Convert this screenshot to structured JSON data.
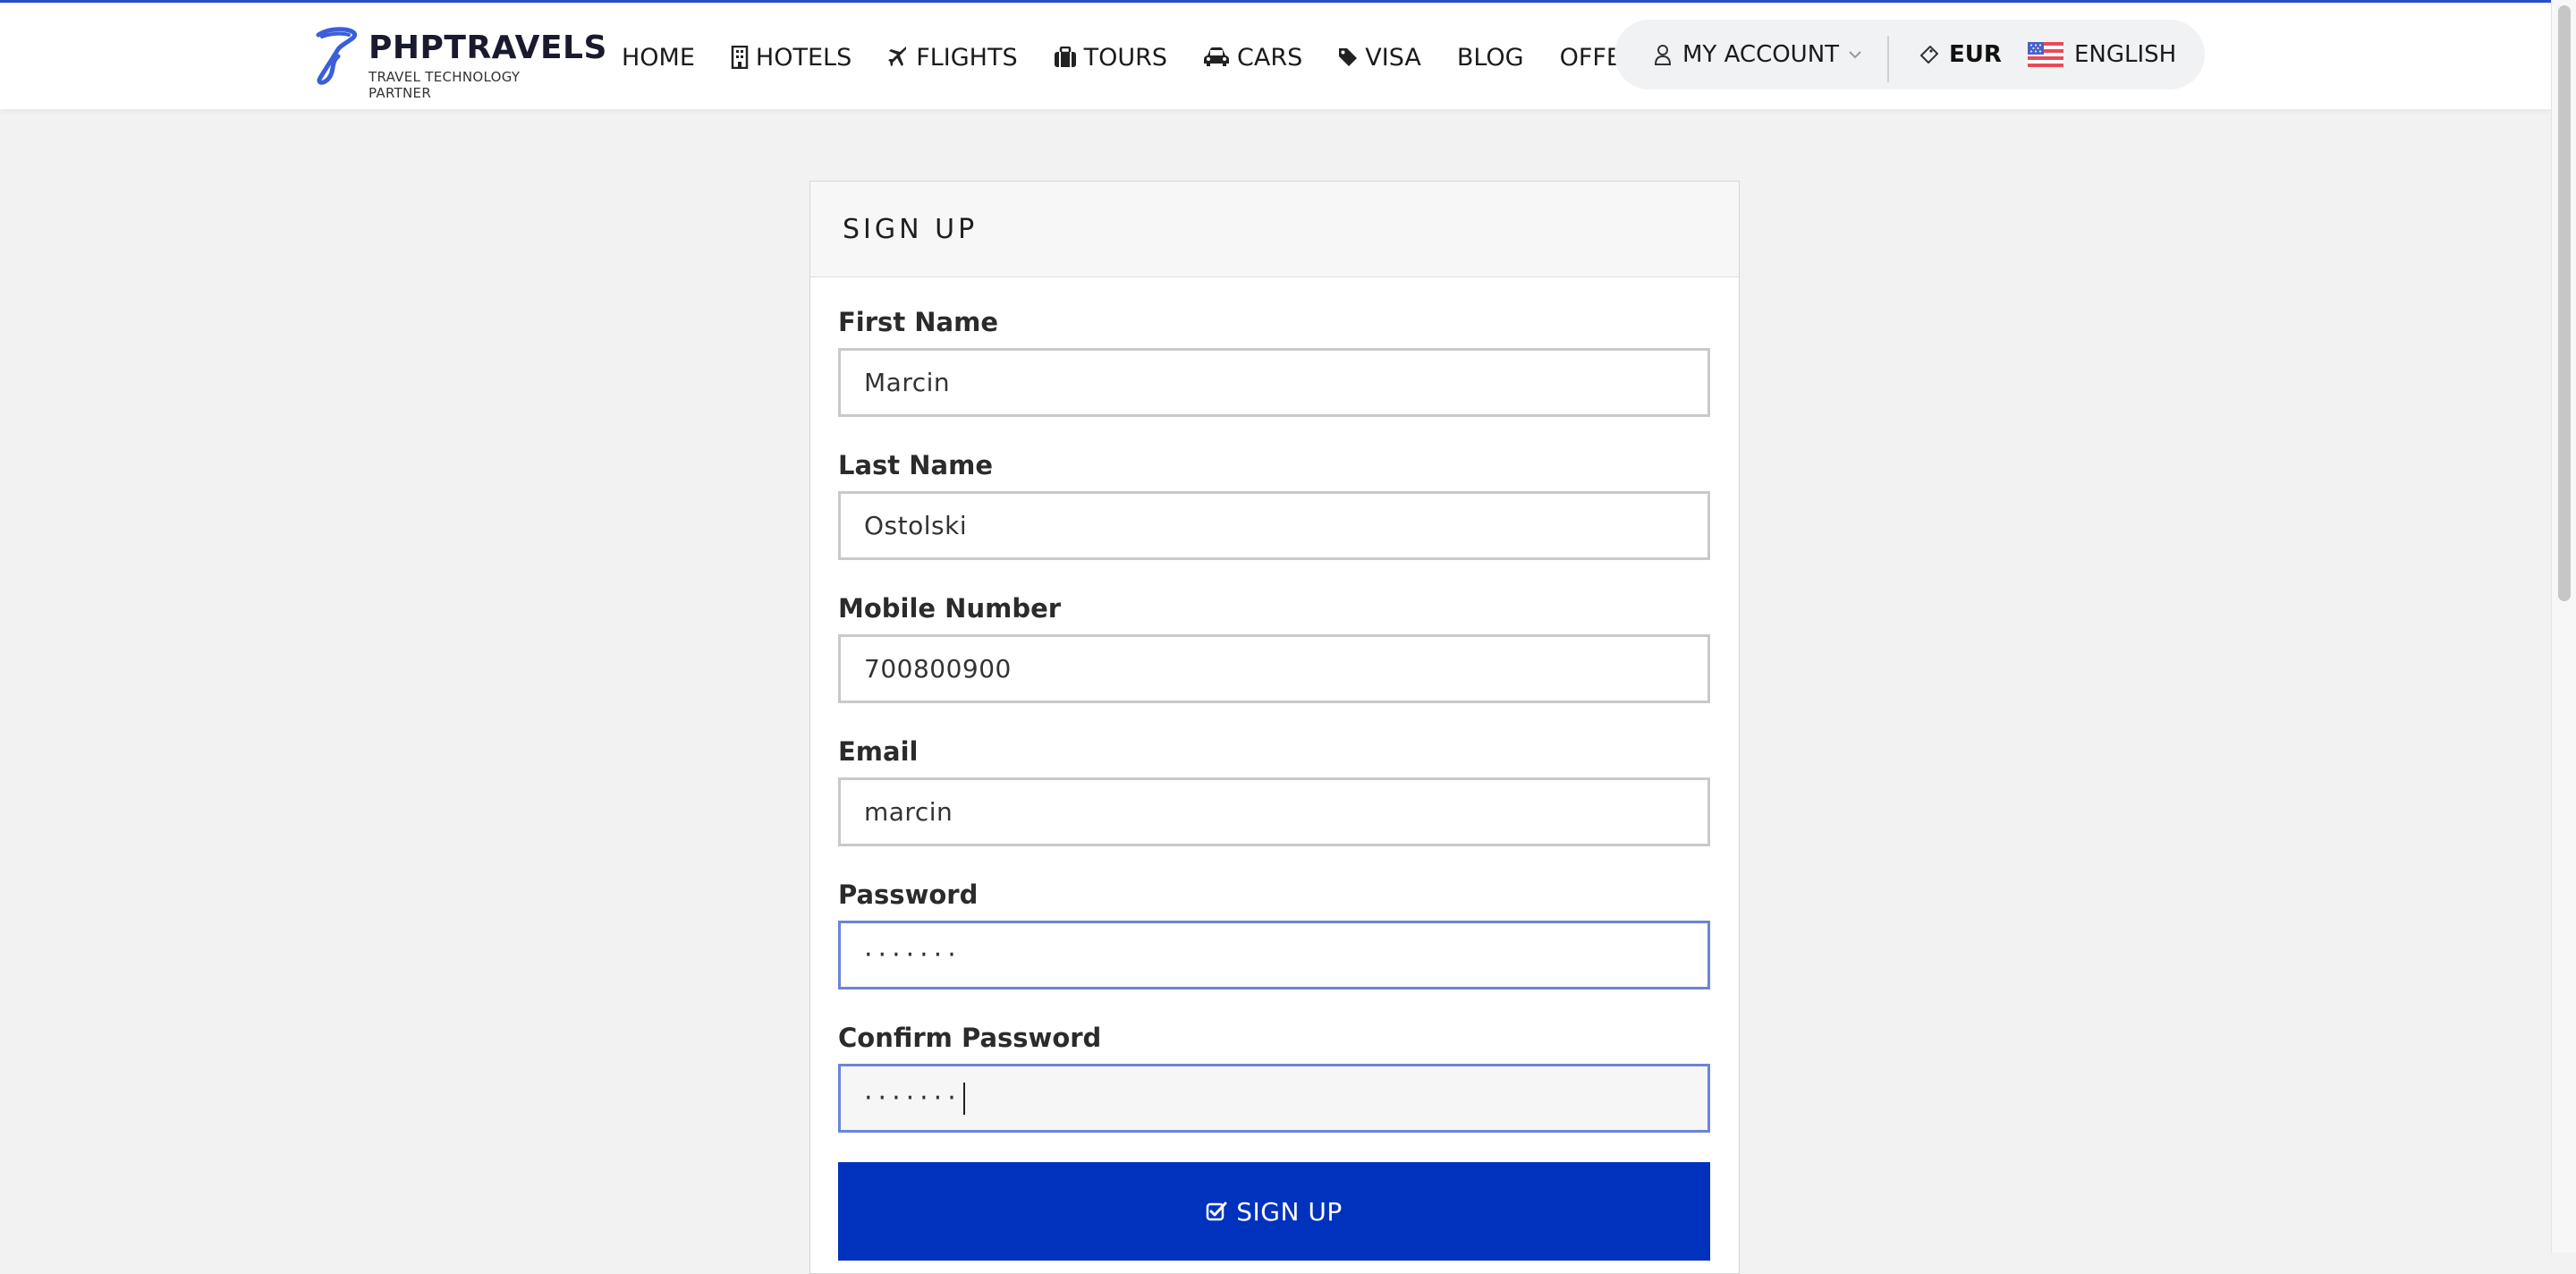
{
  "brand": {
    "name": "PHPTRAVELS",
    "tagline": "TRAVEL TECHNOLOGY PARTNER"
  },
  "nav": {
    "items": [
      {
        "label": "HOME",
        "icon": ""
      },
      {
        "label": "HOTELS",
        "icon": "building-icon"
      },
      {
        "label": "FLIGHTS",
        "icon": "plane-icon"
      },
      {
        "label": "TOURS",
        "icon": "suitcase-icon"
      },
      {
        "label": "CARS",
        "icon": "car-icon"
      },
      {
        "label": "VISA",
        "icon": "tag-icon"
      },
      {
        "label": "BLOG",
        "icon": ""
      },
      {
        "label": "OFFERS",
        "icon": ""
      }
    ],
    "account": "MY ACCOUNT",
    "currency": "EUR",
    "language": "ENGLISH"
  },
  "form": {
    "title": "SIGN UP",
    "fields": [
      {
        "label": "First Name",
        "value": "Marcin"
      },
      {
        "label": "Last Name",
        "value": "Ostolski"
      },
      {
        "label": "Mobile Number",
        "value": "700800900"
      },
      {
        "label": "Email",
        "value": "marcin"
      },
      {
        "label": "Password",
        "value": "·······"
      },
      {
        "label": "Confirm Password",
        "value": "·······"
      }
    ],
    "submit": "SIGN UP"
  },
  "colors": {
    "accent": "#0032bd",
    "topline": "#2a4ccf",
    "focus_border": "#6b85d6"
  }
}
